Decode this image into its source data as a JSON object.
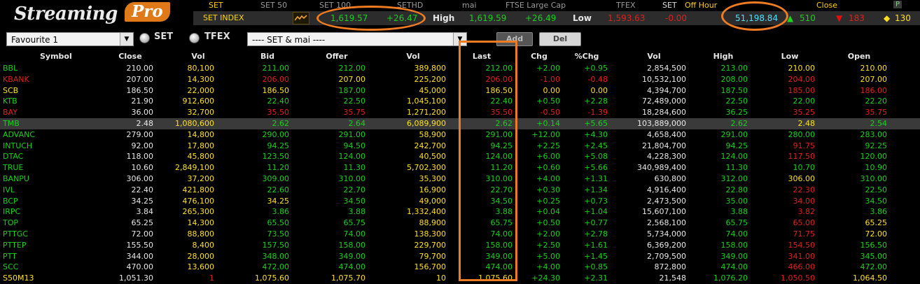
{
  "brand": {
    "part1": "Streaming",
    "part2": "Pro"
  },
  "index_tabs": [
    {
      "label": "SET",
      "active": true
    },
    {
      "label": "SET 50",
      "active": false
    },
    {
      "label": "SET 100",
      "active": false
    },
    {
      "label": "SETHD",
      "active": false
    },
    {
      "label": "mai",
      "active": false
    },
    {
      "label": "FTSE Large Cap",
      "active": false
    },
    {
      "label": "TFEX",
      "active": false
    }
  ],
  "market": {
    "market_label": "SET",
    "session_label": "Off Hour",
    "status": "Close",
    "right_badge": "P"
  },
  "index_row": {
    "name": "SET INDEX",
    "value": "1,619.57",
    "change": "+26.47",
    "high_label": "High",
    "high_value": "1,619.59",
    "high_change": "+26.49",
    "low_label": "Low",
    "low_value": "1,593.63",
    "low_change": "-0.00",
    "volume": "51,198.84",
    "up_count": "510",
    "down_count": "183",
    "unchanged_count": "130"
  },
  "selector": {
    "favourite": "Favourite 1",
    "radio_set": "SET",
    "radio_tfex": "TFEX",
    "market_filter": "---- SET & mai ----",
    "add_label": "Add",
    "del_label": "Del"
  },
  "columns": [
    "Symbol",
    "Close",
    "Vol",
    "Bid",
    "Offer",
    "Vol",
    "Last",
    "Chg",
    "%Chg",
    "Vol",
    "High",
    "Low",
    "Open"
  ],
  "rows": [
    {
      "sym": "BBL",
      "close": "210.00",
      "vol1": "80,100",
      "bid": "211.00",
      "offer": "212.00",
      "vol2": "389,800",
      "last": "212.00",
      "chg": "+2.00",
      "pchg": "+0.95",
      "vol3": "2,854,500",
      "high": "213.00",
      "low": "210.00",
      "open": "210.00",
      "c": [
        "g",
        "w",
        "y",
        "g",
        "g",
        "y",
        "g",
        "g",
        "g",
        "w",
        "g",
        "y",
        "y"
      ],
      "hl": false
    },
    {
      "sym": "KBANK",
      "close": "207.00",
      "vol1": "14,300",
      "bid": "206.00",
      "offer": "207.00",
      "vol2": "225,200",
      "last": "206.00",
      "chg": "-1.00",
      "pchg": "-0.48",
      "vol3": "10,532,100",
      "high": "208.00",
      "low": "204.00",
      "open": "207.00",
      "c": [
        "r",
        "w",
        "y",
        "r",
        "y",
        "y",
        "r",
        "r",
        "r",
        "w",
        "g",
        "r",
        "y"
      ],
      "hl": false
    },
    {
      "sym": "SCB",
      "close": "186.50",
      "vol1": "22,000",
      "bid": "186.50",
      "offer": "187.00",
      "vol2": "45,000",
      "last": "186.50",
      "chg": "0.00",
      "pchg": "0.00",
      "vol3": "4,394,700",
      "high": "187.50",
      "low": "185.00",
      "open": "186.00",
      "c": [
        "y",
        "w",
        "y",
        "y",
        "g",
        "y",
        "y",
        "y",
        "y",
        "w",
        "g",
        "r",
        "r"
      ],
      "hl": false
    },
    {
      "sym": "KTB",
      "close": "21.90",
      "vol1": "912,600",
      "bid": "22.40",
      "offer": "22.50",
      "vol2": "1,045,100",
      "last": "22.40",
      "chg": "+0.50",
      "pchg": "+2.28",
      "vol3": "72,489,000",
      "high": "22.50",
      "low": "22.00",
      "open": "22.20",
      "c": [
        "g",
        "w",
        "y",
        "g",
        "g",
        "y",
        "g",
        "g",
        "g",
        "w",
        "g",
        "g",
        "g"
      ],
      "hl": false
    },
    {
      "sym": "BAY",
      "close": "36.00",
      "vol1": "32,700",
      "bid": "35.50",
      "offer": "35.75",
      "vol2": "1,271,200",
      "last": "35.50",
      "chg": "-0.50",
      "pchg": "-1.39",
      "vol3": "18,284,600",
      "high": "36.25",
      "low": "35.25",
      "open": "35.75",
      "c": [
        "r",
        "w",
        "y",
        "r",
        "r",
        "y",
        "r",
        "r",
        "r",
        "w",
        "g",
        "r",
        "r"
      ],
      "hl": false
    },
    {
      "sym": "TMB",
      "close": "2.48",
      "vol1": "1,080,600",
      "bid": "2.62",
      "offer": "2.64",
      "vol2": "6,089,900",
      "last": "2.62",
      "chg": "+0.14",
      "pchg": "+5.65",
      "vol3": "103,889,000",
      "high": "2.62",
      "low": "2.48",
      "open": "2.54",
      "c": [
        "g",
        "w",
        "y",
        "g",
        "g",
        "y",
        "g",
        "g",
        "g",
        "w",
        "g",
        "y",
        "g"
      ],
      "hl": true
    },
    {
      "sym": "ADVANC",
      "close": "279.00",
      "vol1": "14,800",
      "bid": "290.00",
      "offer": "291.00",
      "vol2": "58,900",
      "last": "291.00",
      "chg": "+12.00",
      "pchg": "+4.30",
      "vol3": "4,658,400",
      "high": "291.00",
      "low": "280.00",
      "open": "283.00",
      "c": [
        "g",
        "w",
        "y",
        "g",
        "g",
        "y",
        "g",
        "g",
        "g",
        "w",
        "g",
        "g",
        "g"
      ],
      "hl": false
    },
    {
      "sym": "INTUCH",
      "close": "92.00",
      "vol1": "17,800",
      "bid": "94.25",
      "offer": "94.50",
      "vol2": "242,700",
      "last": "94.25",
      "chg": "+2.25",
      "pchg": "+2.45",
      "vol3": "21,804,700",
      "high": "94.25",
      "low": "91.75",
      "open": "92.25",
      "c": [
        "g",
        "w",
        "y",
        "g",
        "g",
        "y",
        "g",
        "g",
        "g",
        "w",
        "g",
        "r",
        "g"
      ],
      "hl": false
    },
    {
      "sym": "DTAC",
      "close": "118.00",
      "vol1": "45,800",
      "bid": "123.50",
      "offer": "124.00",
      "vol2": "40,500",
      "last": "124.00",
      "chg": "+6.00",
      "pchg": "+5.08",
      "vol3": "4,228,300",
      "high": "124.00",
      "low": "117.50",
      "open": "120.00",
      "c": [
        "g",
        "w",
        "y",
        "g",
        "g",
        "y",
        "g",
        "g",
        "g",
        "w",
        "g",
        "r",
        "g"
      ],
      "hl": false
    },
    {
      "sym": "TRUE",
      "close": "10.60",
      "vol1": "2,849,100",
      "bid": "11.20",
      "offer": "11.30",
      "vol2": "5,702,300",
      "last": "11.20",
      "chg": "+0.60",
      "pchg": "+5.66",
      "vol3": "340,989,400",
      "high": "11.30",
      "low": "10.70",
      "open": "10.90",
      "c": [
        "g",
        "w",
        "y",
        "g",
        "g",
        "y",
        "g",
        "g",
        "g",
        "w",
        "g",
        "g",
        "g"
      ],
      "hl": false
    },
    {
      "sym": "BANPU",
      "close": "306.00",
      "vol1": "37,200",
      "bid": "309.00",
      "offer": "310.00",
      "vol2": "35,300",
      "last": "310.00",
      "chg": "+4.00",
      "pchg": "+1.31",
      "vol3": "630,800",
      "high": "312.00",
      "low": "306.00",
      "open": "310.00",
      "c": [
        "g",
        "w",
        "y",
        "g",
        "g",
        "y",
        "g",
        "g",
        "g",
        "w",
        "g",
        "y",
        "g"
      ],
      "hl": false
    },
    {
      "sym": "IVL",
      "close": "22.40",
      "vol1": "421,800",
      "bid": "22.60",
      "offer": "22.70",
      "vol2": "16,900",
      "last": "22.70",
      "chg": "+0.30",
      "pchg": "+1.34",
      "vol3": "4,916,400",
      "high": "22.80",
      "low": "22.30",
      "open": "22.50",
      "c": [
        "g",
        "w",
        "y",
        "g",
        "g",
        "y",
        "g",
        "g",
        "g",
        "w",
        "g",
        "r",
        "g"
      ],
      "hl": false
    },
    {
      "sym": "BCP",
      "close": "34.25",
      "vol1": "476,100",
      "bid": "34.25",
      "offer": "34.50",
      "vol2": "49,000",
      "last": "34.50",
      "chg": "+0.25",
      "pchg": "+0.73",
      "vol3": "2,473,500",
      "high": "35.00",
      "low": "34.00",
      "open": "34.50",
      "c": [
        "g",
        "w",
        "y",
        "y",
        "g",
        "y",
        "g",
        "g",
        "g",
        "w",
        "g",
        "r",
        "g"
      ],
      "hl": false
    },
    {
      "sym": "IRPC",
      "close": "3.84",
      "vol1": "265,300",
      "bid": "3.86",
      "offer": "3.88",
      "vol2": "1,332,400",
      "last": "3.88",
      "chg": "+0.04",
      "pchg": "+1.04",
      "vol3": "15,607,100",
      "high": "3.88",
      "low": "3.82",
      "open": "3.86",
      "c": [
        "g",
        "w",
        "y",
        "g",
        "g",
        "y",
        "g",
        "g",
        "g",
        "w",
        "g",
        "r",
        "g"
      ],
      "hl": false
    },
    {
      "sym": "TOP",
      "close": "65.25",
      "vol1": "14,300",
      "bid": "65.50",
      "offer": "65.75",
      "vol2": "88,900",
      "last": "65.75",
      "chg": "+0.50",
      "pchg": "+0.77",
      "vol3": "2,568,100",
      "high": "65.75",
      "low": "65.00",
      "open": "65.25",
      "c": [
        "g",
        "w",
        "y",
        "g",
        "g",
        "y",
        "g",
        "g",
        "g",
        "w",
        "g",
        "r",
        "y"
      ],
      "hl": false
    },
    {
      "sym": "PTTGC",
      "close": "72.00",
      "vol1": "88,800",
      "bid": "73.50",
      "offer": "74.00",
      "vol2": "138,300",
      "last": "74.00",
      "chg": "+2.00",
      "pchg": "+2.78",
      "vol3": "5,734,000",
      "high": "74.00",
      "low": "71.75",
      "open": "72.00",
      "c": [
        "g",
        "w",
        "y",
        "g",
        "g",
        "y",
        "g",
        "g",
        "g",
        "w",
        "g",
        "r",
        "y"
      ],
      "hl": false
    },
    {
      "sym": "PTTEP",
      "close": "155.50",
      "vol1": "8,400",
      "bid": "157.50",
      "offer": "158.00",
      "vol2": "229,700",
      "last": "158.00",
      "chg": "+2.50",
      "pchg": "+1.61",
      "vol3": "6,369,200",
      "high": "158.00",
      "low": "154.50",
      "open": "156.50",
      "c": [
        "g",
        "w",
        "y",
        "g",
        "g",
        "y",
        "g",
        "g",
        "g",
        "w",
        "g",
        "r",
        "g"
      ],
      "hl": false
    },
    {
      "sym": "PTT",
      "close": "344.00",
      "vol1": "28,000",
      "bid": "348.00",
      "offer": "349.00",
      "vol2": "79,700",
      "last": "349.00",
      "chg": "+5.00",
      "pchg": "+1.45",
      "vol3": "2,709,500",
      "high": "349.00",
      "low": "341.00",
      "open": "345.00",
      "c": [
        "g",
        "w",
        "y",
        "g",
        "g",
        "y",
        "g",
        "g",
        "g",
        "w",
        "g",
        "r",
        "g"
      ],
      "hl": false
    },
    {
      "sym": "SCC",
      "close": "470.00",
      "vol1": "13,600",
      "bid": "472.00",
      "offer": "474.00",
      "vol2": "156,700",
      "last": "474.00",
      "chg": "+4.00",
      "pchg": "+0.85",
      "vol3": "872,800",
      "high": "474.00",
      "low": "466.00",
      "open": "472.00",
      "c": [
        "g",
        "w",
        "y",
        "g",
        "g",
        "y",
        "g",
        "g",
        "g",
        "w",
        "g",
        "r",
        "g"
      ],
      "hl": false
    },
    {
      "sym": "S50M13",
      "close": "1,051.30",
      "vol1": "1",
      "bid": "1,075.60",
      "offer": "1,075.70",
      "vol2": "10",
      "last": "1,075.60",
      "chg": "+24.30",
      "pchg": "+2.31",
      "vol3": "21,548",
      "high": "1,076.20",
      "low": "1,050.50",
      "open": "1,064.50",
      "c": [
        "y",
        "w",
        "r",
        "y",
        "y",
        "y",
        "y",
        "g",
        "g",
        "w",
        "g",
        "r",
        "y"
      ],
      "hl": false
    }
  ],
  "colors": {
    "up": "#18d21a",
    "down": "#e0201a",
    "unchanged": "#ffe020",
    "highlight": "#f07c22"
  }
}
